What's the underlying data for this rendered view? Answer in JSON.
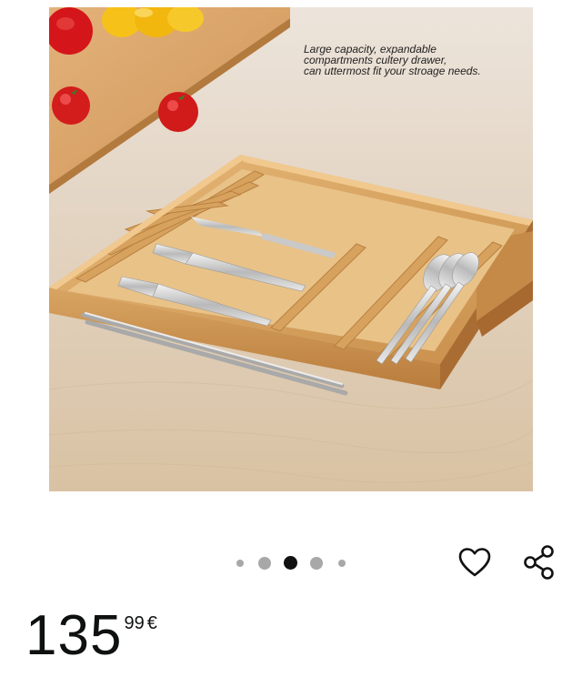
{
  "product": {
    "image_caption": {
      "line1": "Large capacity, expandable",
      "line2": "compartments cultery drawer,",
      "line3": "can uttermost fit your stroage needs."
    },
    "carousel": {
      "total_dots": 5,
      "active_index": 2
    },
    "actions": {
      "wishlist_icon": "heart-outline-icon",
      "share_icon": "share-icon"
    },
    "price": {
      "whole": "135",
      "fraction": "99",
      "currency": "€"
    }
  }
}
